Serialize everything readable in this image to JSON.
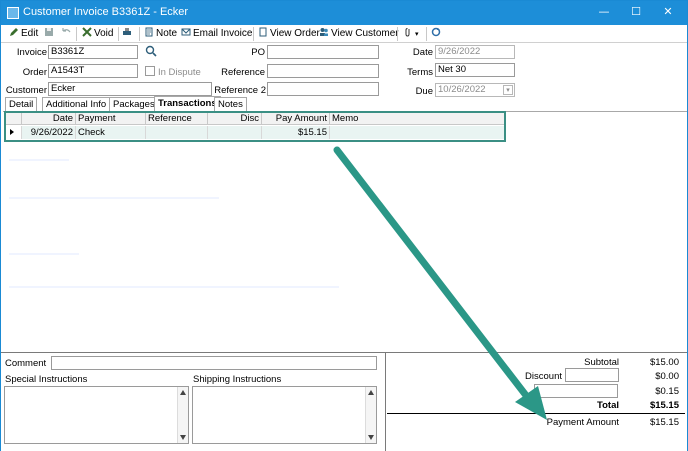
{
  "window": {
    "title": "Customer Invoice B3361Z - Ecker",
    "minimize": "—",
    "maximize": "☐",
    "close": "✕"
  },
  "toolbar": {
    "edit": "Edit",
    "void": "Void",
    "note": "Note",
    "email_invoice": "Email Invoice",
    "view_order": "View Order",
    "view_customer": "View Customer"
  },
  "header": {
    "invoice_label": "Invoice",
    "invoice_value": "B3361Z",
    "order_label": "Order",
    "order_value": "A1543T",
    "in_dispute_label": "In Dispute",
    "customer_label": "Customer",
    "customer_value": "Ecker",
    "po_label": "PO",
    "po_value": "",
    "reference_label": "Reference",
    "reference_value": "",
    "reference2_label": "Reference 2",
    "reference2_value": "",
    "date_label": "Date",
    "date_value": "9/26/2022",
    "terms_label": "Terms",
    "terms_value": "Net 30",
    "due_label": "Due",
    "due_value": "10/26/2022"
  },
  "tabs": [
    "Detail",
    "Additional Info",
    "Packages",
    "Transactions",
    "Notes"
  ],
  "active_tab": "Transactions",
  "grid": {
    "columns": [
      "Date",
      "Payment",
      "Reference",
      "Disc",
      "Pay Amount",
      "Memo"
    ],
    "rows": [
      {
        "date": "9/26/2022",
        "payment": "Check",
        "reference": "",
        "disc": "",
        "pay_amount": "$15.15",
        "memo": ""
      }
    ]
  },
  "bottom": {
    "comment_label": "Comment",
    "comment_value": "",
    "special_instructions_label": "Special Instructions",
    "shipping_instructions_label": "Shipping Instructions"
  },
  "totals": {
    "subtotal_label": "Subtotal",
    "subtotal_value": "$15.00",
    "discount_label": "Discount",
    "discount_value": "$0.00",
    "tax_value": "$0.15",
    "total_label": "Total",
    "total_value": "$15.15",
    "payment_amount_label": "Payment Amount",
    "payment_amount_value": "$15.15"
  },
  "colors": {
    "titlebar": "#1d8ed8",
    "annotation_arrow": "#2b9787",
    "grid_highlight": "#3b8f84"
  }
}
